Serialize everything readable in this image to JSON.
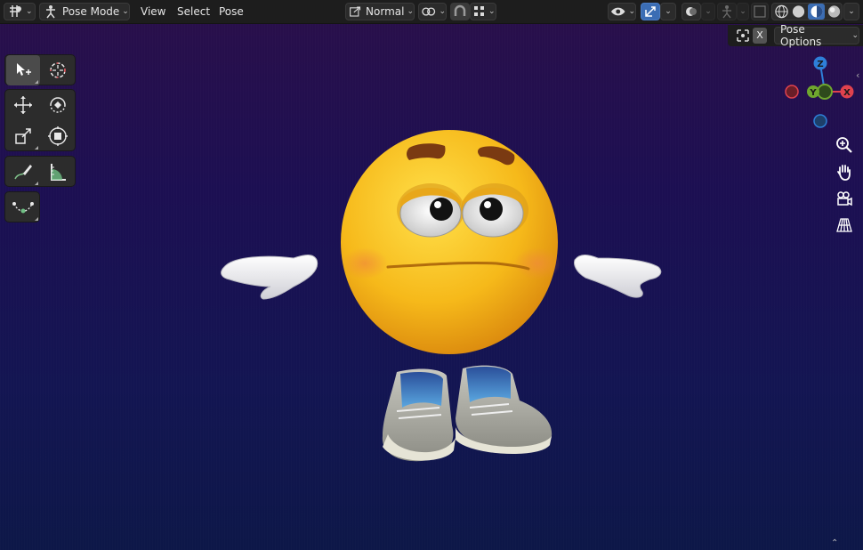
{
  "header": {
    "mode_label": "Pose Mode",
    "menus": [
      "View",
      "Select",
      "Pose"
    ],
    "orientation_label": "Normal"
  },
  "overlay": {
    "x_label": "X",
    "pose_options_label": "Pose Options"
  },
  "gizmo": {
    "z_label": "Z",
    "y_label": "Y",
    "x_label": "X"
  },
  "colors": {
    "gizmo_x": "#e0424e",
    "gizmo_y": "#6fa72e",
    "gizmo_z": "#2e7fd8",
    "active_blue": "#3b6db4"
  },
  "icons": {
    "toolbar": [
      "select-box-icon",
      "cursor-icon",
      "move-icon",
      "rotate-icon",
      "scale-icon",
      "transform-icon",
      "annotate-icon",
      "measure-icon",
      "relax-pose-icon"
    ],
    "navigation": [
      "zoom-icon",
      "pan-hand-icon",
      "camera-view-icon",
      "perspective-grid-icon"
    ]
  }
}
